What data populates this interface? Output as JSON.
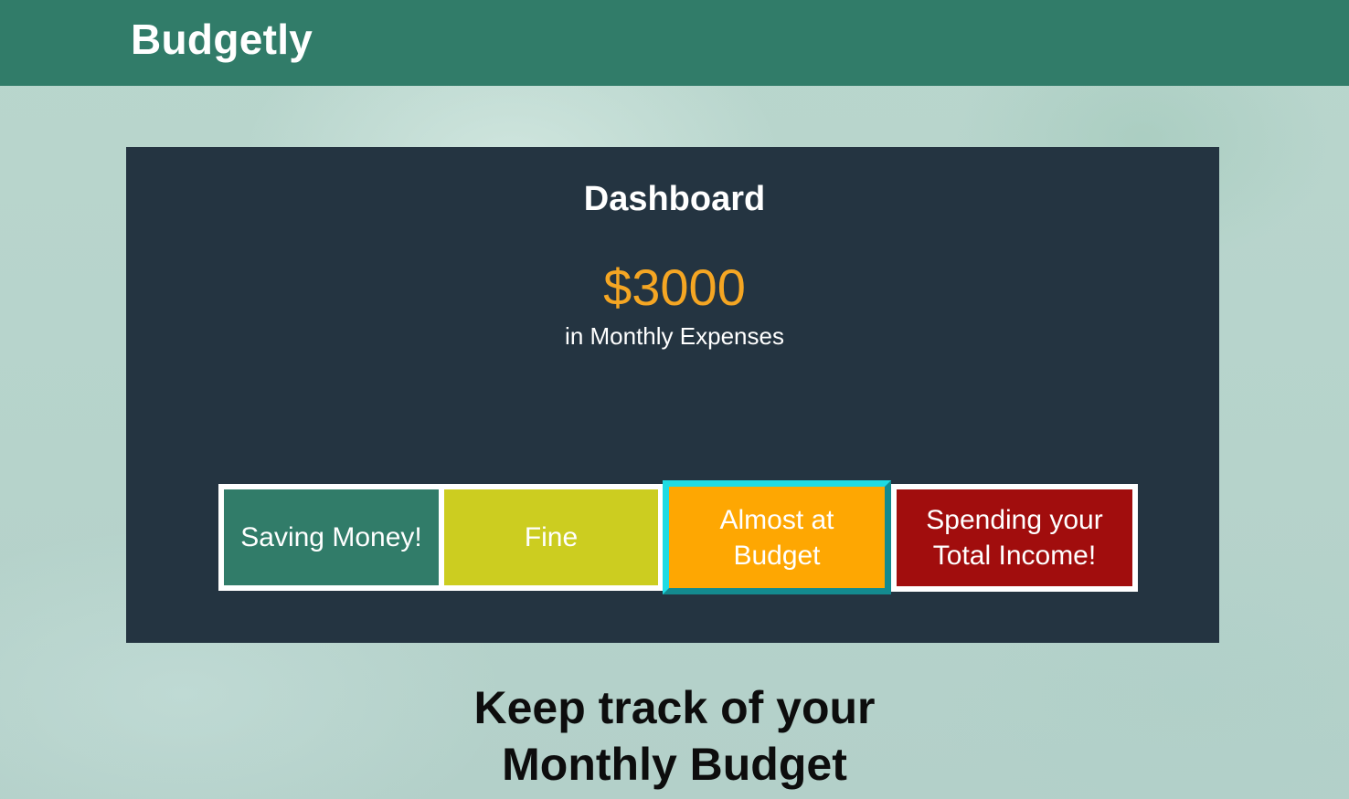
{
  "header": {
    "brand": "Budgetly"
  },
  "dashboard": {
    "title": "Dashboard",
    "amount": "$3000",
    "amount_caption": "in Monthly Expenses",
    "statuses": [
      {
        "line1": "Saving Money!",
        "line2": "",
        "color": "#317c69"
      },
      {
        "line1": "Fine",
        "line2": "",
        "color": "#cccd20"
      },
      {
        "line1": "Almost at",
        "line2": "Budget",
        "color": "#fea702",
        "selected": true
      },
      {
        "line1": "Spending your",
        "line2": "Total Income!",
        "color": "#a10d0d"
      }
    ]
  },
  "tagline": {
    "line1": "Keep track of your",
    "line2": "Monthly Budget"
  },
  "colors": {
    "navbar": "#317c69",
    "panel": "#243441",
    "amount": "#f5a623",
    "selected_border": "#1fdbe3"
  }
}
